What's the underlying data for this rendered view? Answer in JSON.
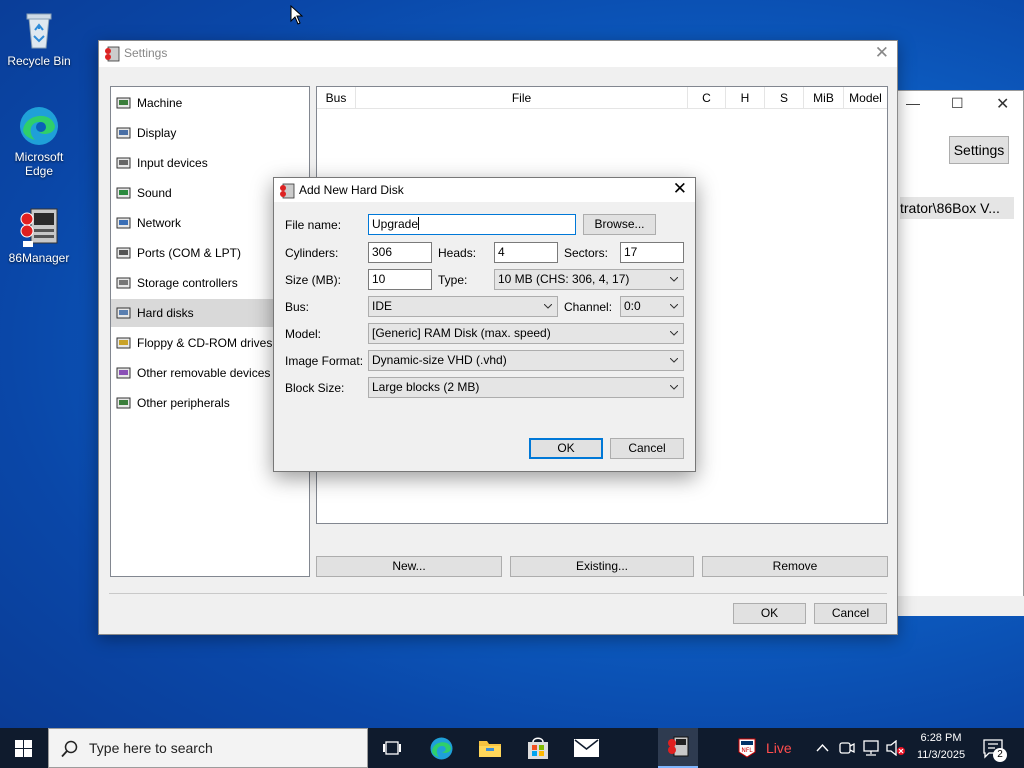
{
  "desktop": {
    "icons": [
      {
        "label": "Recycle Bin"
      },
      {
        "label": "Microsoft Edge"
      },
      {
        "label": "86Manager"
      }
    ]
  },
  "background_window": {
    "settings_button": "Settings",
    "row_text": "trator\\86Box V..."
  },
  "settings": {
    "title": "Settings",
    "categories": [
      {
        "label": "Machine",
        "icon": "machine-icon"
      },
      {
        "label": "Display",
        "icon": "display-icon"
      },
      {
        "label": "Input devices",
        "icon": "input-devices-icon"
      },
      {
        "label": "Sound",
        "icon": "sound-icon"
      },
      {
        "label": "Network",
        "icon": "network-icon"
      },
      {
        "label": "Ports (COM & LPT)",
        "icon": "ports-icon"
      },
      {
        "label": "Storage controllers",
        "icon": "storage-icon"
      },
      {
        "label": "Hard disks",
        "icon": "hard-disk-icon",
        "selected": true
      },
      {
        "label": "Floppy & CD-ROM drives",
        "icon": "floppy-icon"
      },
      {
        "label": "Other removable devices",
        "icon": "removable-icon"
      },
      {
        "label": "Other peripherals",
        "icon": "peripherals-icon"
      }
    ],
    "columns": [
      "Bus",
      "File",
      "C",
      "H",
      "S",
      "MiB",
      "Model"
    ],
    "buttons": {
      "new": "New...",
      "existing": "Existing...",
      "remove": "Remove",
      "ok": "OK",
      "cancel": "Cancel"
    }
  },
  "dialog": {
    "title": "Add New Hard Disk",
    "file_name_label": "File name:",
    "file_name_value": "Upgrade",
    "browse": "Browse...",
    "cylinders_label": "Cylinders:",
    "cylinders_value": "306",
    "heads_label": "Heads:",
    "heads_value": "4",
    "sectors_label": "Sectors:",
    "sectors_value": "17",
    "size_label": "Size (MB):",
    "size_value": "10",
    "type_label": "Type:",
    "type_value": "10 MB (CHS: 306, 4, 17)",
    "bus_label": "Bus:",
    "bus_value": "IDE",
    "channel_label": "Channel:",
    "channel_value": "0:0",
    "model_label": "Model:",
    "model_value": "[Generic] RAM Disk (max. speed)",
    "image_format_label": "Image Format:",
    "image_format_value": "Dynamic-size VHD (.vhd)",
    "block_size_label": "Block Size:",
    "block_size_value": "Large blocks (2 MB)",
    "ok": "OK",
    "cancel": "Cancel"
  },
  "taskbar": {
    "search_placeholder": "Type here to search",
    "live_label": "Live",
    "time": "6:28 PM",
    "date": "11/3/2025",
    "notification_count": "2"
  }
}
